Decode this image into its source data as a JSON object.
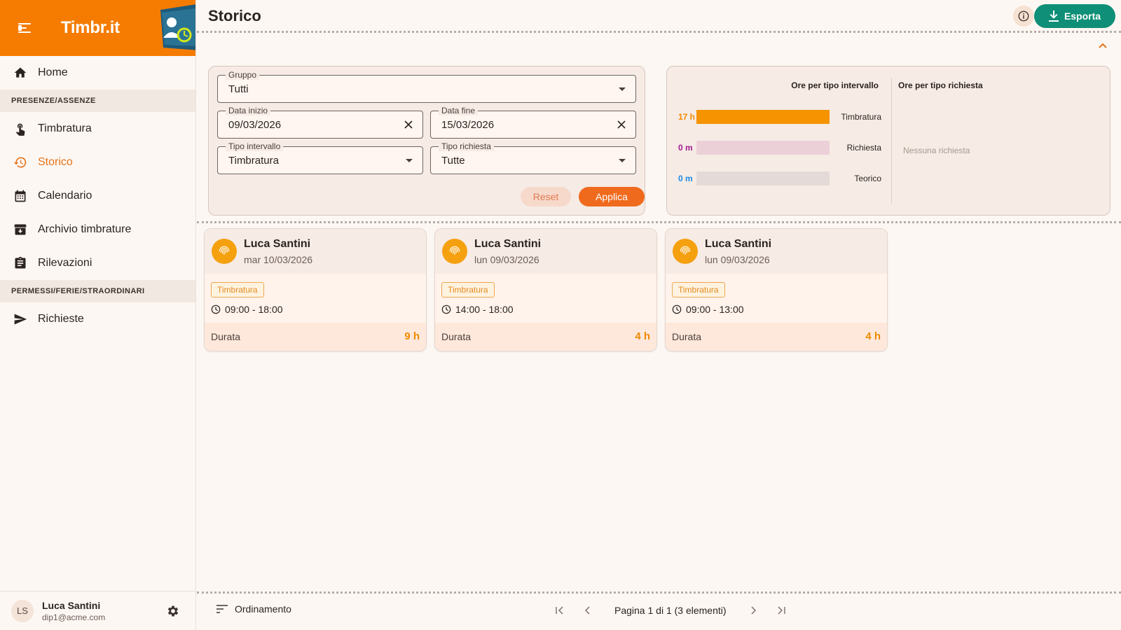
{
  "app": {
    "brand": "Timbr.it"
  },
  "sidebar": {
    "home": "Home",
    "section1": "PRESENZE/ASSENZE",
    "items1": [
      {
        "label": "Timbratura"
      },
      {
        "label": "Storico"
      },
      {
        "label": "Calendario"
      },
      {
        "label": "Archivio timbrature"
      },
      {
        "label": "Rilevazioni"
      }
    ],
    "section2": "PERMESSI/FERIE/STRAORDINARI",
    "items2": [
      {
        "label": "Richieste"
      }
    ],
    "active": "Storico"
  },
  "user": {
    "initials": "LS",
    "name": "Luca Santini",
    "email": "dip1@acme.com"
  },
  "header": {
    "title": "Storico",
    "export_label": "Esporta"
  },
  "filters": {
    "gruppo": {
      "label": "Gruppo",
      "value": "Tutti"
    },
    "data_inizio": {
      "label": "Data inizio",
      "value": "09/03/2026"
    },
    "data_fine": {
      "label": "Data fine",
      "value": "15/03/2026"
    },
    "tipo_intervallo": {
      "label": "Tipo intervallo",
      "value": "Timbratura"
    },
    "tipo_richiesta": {
      "label": "Tipo richiesta",
      "value": "Tutte"
    },
    "reset_label": "Reset",
    "apply_label": "Applica"
  },
  "stats": {
    "header_intervallo": "Ore per tipo intervallo",
    "header_richiesta": "Ore per tipo richiesta",
    "rows": [
      {
        "value": "17 h",
        "label": "Timbratura",
        "fraction": 1.0,
        "color": "#f59300",
        "track": "#f59300",
        "numColor": "#f08a00"
      },
      {
        "value": "0 m",
        "label": "Richiesta",
        "fraction": 0.0,
        "color": "#b3229a",
        "track": "#ecd0d8",
        "numColor": "#a21c8f"
      },
      {
        "value": "0 m",
        "label": "Teorico",
        "fraction": 0.0,
        "color": "#1e88e5",
        "track": "#e4dbd8",
        "numColor": "#1e88e5"
      }
    ],
    "empty_richieste": "Nessuna richiesta"
  },
  "cards": [
    {
      "name": "Luca Santini",
      "date": "mar 10/03/2026",
      "tag": "Timbratura",
      "time": "09:00 - 18:00",
      "duration_label": "Durata",
      "duration": "9 h"
    },
    {
      "name": "Luca Santini",
      "date": "lun 09/03/2026",
      "tag": "Timbratura",
      "time": "14:00 - 18:00",
      "duration_label": "Durata",
      "duration": "4 h"
    },
    {
      "name": "Luca Santini",
      "date": "lun 09/03/2026",
      "tag": "Timbratura",
      "time": "09:00 - 13:00",
      "duration_label": "Durata",
      "duration": "4 h"
    }
  ],
  "footer": {
    "sort_label": "Ordinamento",
    "pagination": "Pagina 1 di 1 (3 elementi)"
  },
  "colors": {
    "brand": "#f57c00",
    "accent": "#e6731a",
    "export": "#0f8f77"
  }
}
